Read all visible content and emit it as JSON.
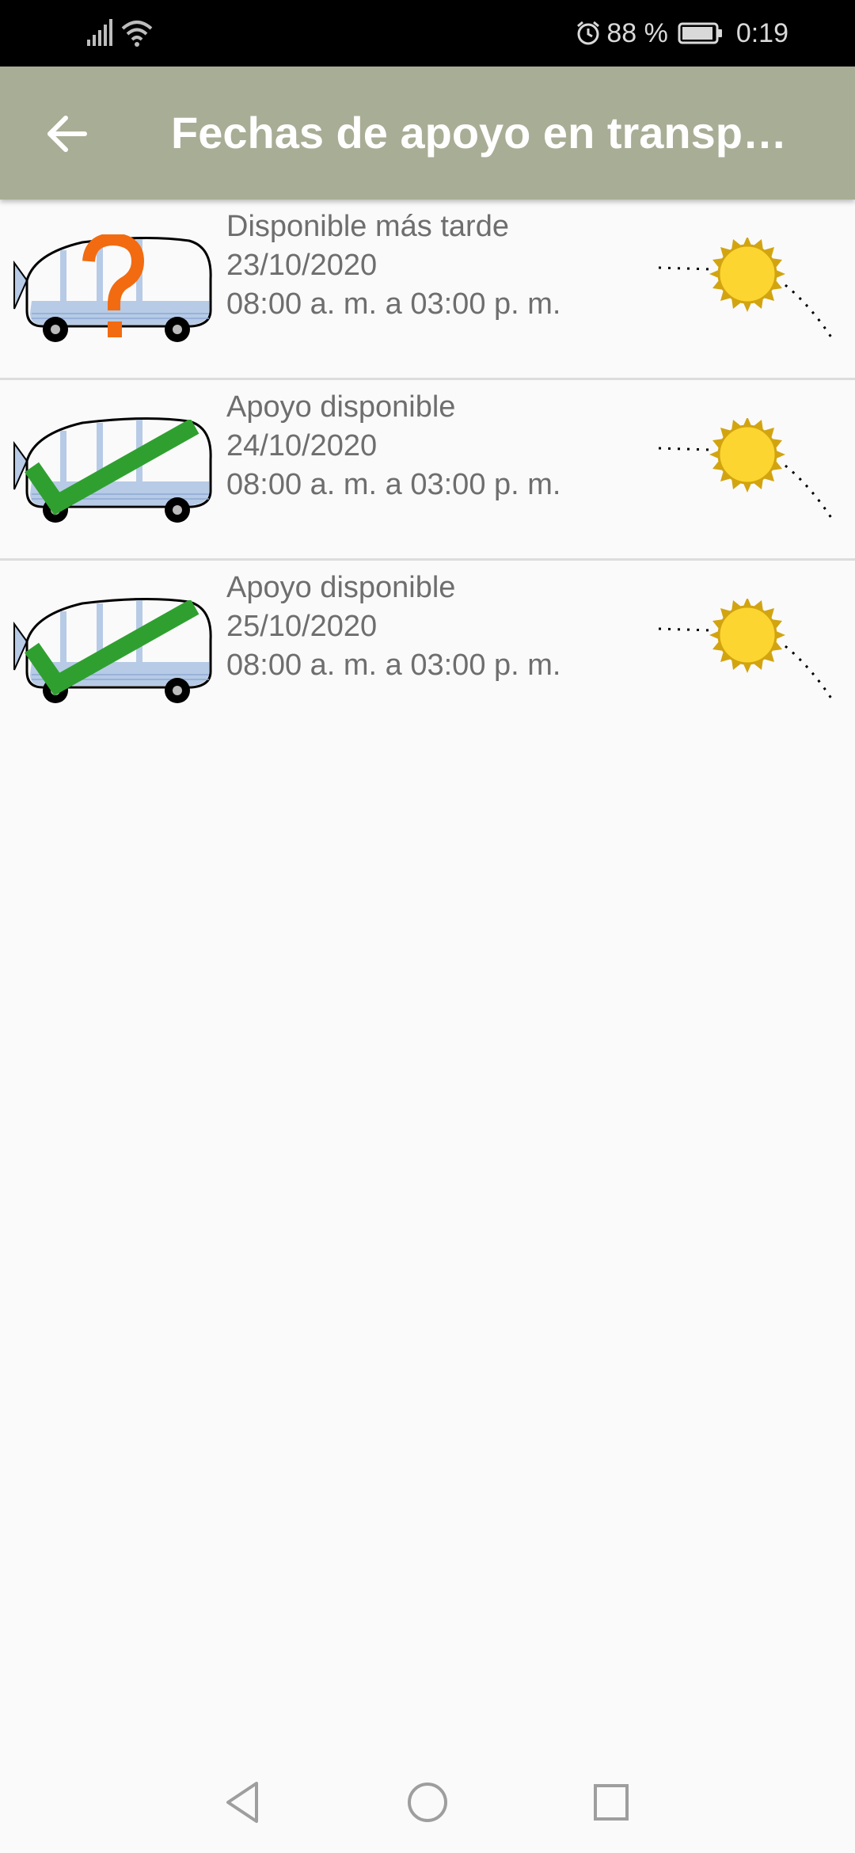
{
  "status_bar": {
    "battery_percent": "88 %",
    "time": "0:19",
    "icons": [
      "signal-icon",
      "wifi-icon",
      "alarm-icon",
      "battery-icon"
    ]
  },
  "app_bar": {
    "title": "Fechas de apoyo en transporte",
    "back_icon": "arrow-left-icon",
    "color": "#a8ad95"
  },
  "items": [
    {
      "status": "Disponible más tarde",
      "date": "23/10/2020",
      "hours": "08:00 a. m. a 03:00 p. m.",
      "badge_icon": "question-mark-icon",
      "badge_color": "#f26b10"
    },
    {
      "status": "Apoyo disponible",
      "date": "24/10/2020",
      "hours": "08:00 a. m. a 03:00 p. m.",
      "badge_icon": "checkmark-icon",
      "badge_color": "#2fa02f"
    },
    {
      "status": "Apoyo disponible",
      "date": "25/10/2020",
      "hours": "08:00 a. m. a 03:00 p. m.",
      "badge_icon": "checkmark-icon",
      "badge_color": "#2fa02f"
    }
  ],
  "nav_bar": {
    "icons": [
      "nav-back-icon",
      "nav-home-icon",
      "nav-recents-icon"
    ]
  }
}
